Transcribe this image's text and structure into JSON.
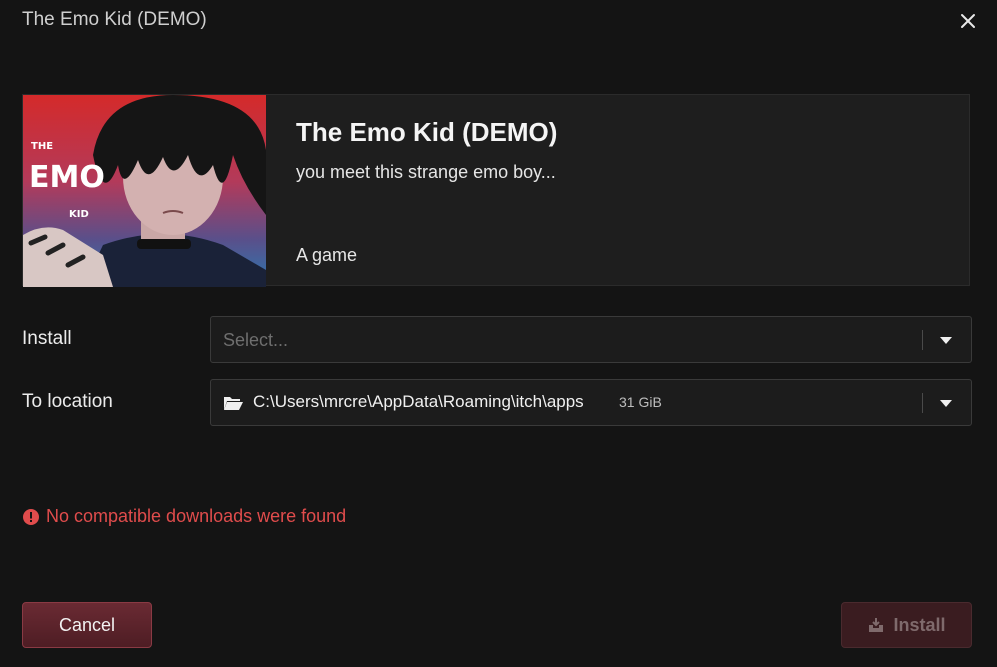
{
  "window": {
    "title": "The Emo Kid (DEMO)"
  },
  "game": {
    "cover_text_top": "THE",
    "cover_text_main": "EMO",
    "cover_text_bottom": "KID",
    "title": "The Emo Kid (DEMO)",
    "description": "you meet this strange emo boy...",
    "type": "A game"
  },
  "install": {
    "label": "Install",
    "placeholder": "Select..."
  },
  "location": {
    "label": "To location",
    "path": "C:\\Users\\mrcre\\AppData\\Roaming\\itch\\apps",
    "free_space": "31 GiB"
  },
  "error": {
    "message": "No compatible downloads were found"
  },
  "buttons": {
    "cancel": "Cancel",
    "install": "Install"
  },
  "colors": {
    "accent": "#6a2a33",
    "error": "#e04c4c",
    "background": "#141414"
  },
  "icons": [
    "close-icon",
    "chevron-down-icon",
    "folder-icon",
    "error-icon",
    "install-icon"
  ]
}
